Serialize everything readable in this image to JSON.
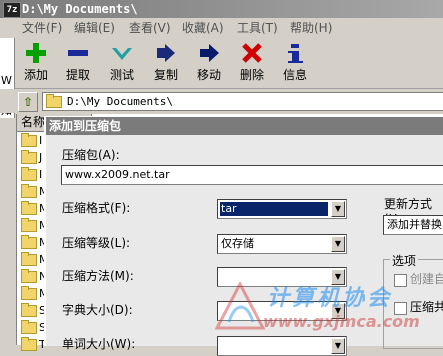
{
  "window": {
    "app_icon": "7z",
    "title": "D:\\My Documents\\"
  },
  "menu": [
    "文件(F)",
    "编辑(E)",
    "查看(V)",
    "收藏(A)",
    "工具(T)",
    "帮助(H)"
  ],
  "toolbar": [
    {
      "label": "添加",
      "icon": "add-icon",
      "color": "#00a000"
    },
    {
      "label": "提取",
      "icon": "extract-icon",
      "color": "#1a2a9a"
    },
    {
      "label": "测试",
      "icon": "test-icon",
      "color": "#20a0a0"
    },
    {
      "label": "复制",
      "icon": "copy-icon",
      "color": "#1a2a7a"
    },
    {
      "label": "移动",
      "icon": "move-icon",
      "color": "#0a1a6a"
    },
    {
      "label": "删除",
      "icon": "delete-icon",
      "color": "#d00000"
    },
    {
      "label": "信息",
      "icon": "info-icon",
      "color": "#1a2a9a"
    }
  ],
  "left_partial": [
    "W",
    "知"
  ],
  "address": {
    "path": "D:\\My Documents\\"
  },
  "file_list": {
    "header": "名称",
    "rows": [
      "I",
      "J",
      "I",
      "M",
      "M",
      "M",
      "M",
      "M",
      "N",
      "M",
      "S",
      "S",
      "T"
    ]
  },
  "dialog": {
    "title": "添加到压缩包",
    "archive_label": "压缩包(A):",
    "archive_value": "www.x2009.net.tar",
    "format_label": "压缩格式(F):",
    "format_value": "tar",
    "level_label": "压缩等级(L):",
    "level_value": "仅存储",
    "method_label": "压缩方法(M):",
    "method_value": "",
    "dict_label": "字典大小(D):",
    "dict_value": "",
    "word_label": "单词大小(W):",
    "update_label": "更新方式(U",
    "update_value": "添加并替换",
    "options_title": "选项",
    "option_sfx": "创建自",
    "option_shared": "压缩共"
  },
  "watermark": {
    "title": "计算机协会",
    "url": "www.gxjmca.com"
  }
}
